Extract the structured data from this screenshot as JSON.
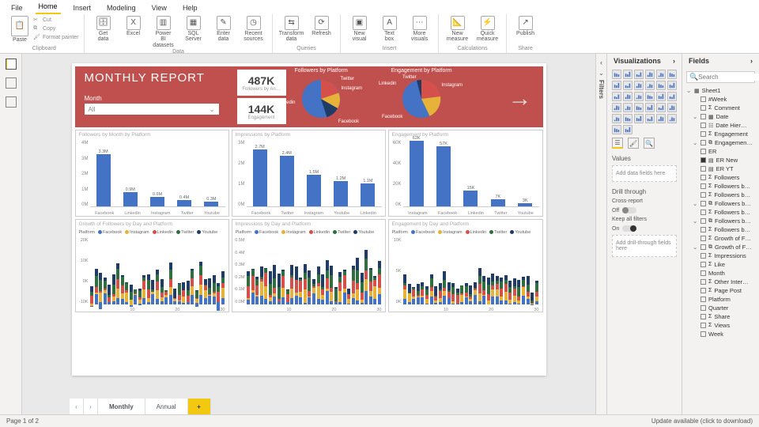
{
  "tabs": [
    "File",
    "Home",
    "Insert",
    "Modeling",
    "View",
    "Help"
  ],
  "active_tab": "Home",
  "ribbon": {
    "clipboard": {
      "label": "Clipboard",
      "paste": "Paste",
      "cut": "Cut",
      "copy": "Copy",
      "fp": "Format painter"
    },
    "data": {
      "label": "Data",
      "items": [
        "Get data",
        "Excel",
        "Power BI datasets",
        "SQL Server",
        "Enter data",
        "Recent sources"
      ]
    },
    "queries": {
      "label": "Queries",
      "items": [
        "Transform data",
        "Refresh"
      ]
    },
    "insert": {
      "label": "Insert",
      "items": [
        "New visual",
        "Text box",
        "More visuals"
      ]
    },
    "calc": {
      "label": "Calculations",
      "items": [
        "New measure",
        "Quick measure"
      ]
    },
    "share": {
      "label": "Share",
      "items": [
        "Publish"
      ]
    }
  },
  "pageinfo": "Page 1 of 2",
  "update": "Update available (click to download)",
  "pages": [
    "Monthly",
    "Annual"
  ],
  "active_page": "Monthly",
  "filters_label": "Filters",
  "viz": {
    "title": "Visualizations",
    "values": "Values",
    "addfields": "Add data fields here",
    "drill": "Drill through",
    "cross": "Cross-report",
    "off": "Off",
    "keep": "Keep all filters",
    "on": "On",
    "adddrill": "Add drill-through fields here"
  },
  "fields": {
    "title": "Fields",
    "search": "Search",
    "table": "Sheet1",
    "items": [
      {
        "name": "#Week",
        "lvl": 2,
        "sigma": false
      },
      {
        "name": "Comment",
        "lvl": 2,
        "sigma": true
      },
      {
        "name": "Date",
        "lvl": 2,
        "expand": true,
        "calendar": true
      },
      {
        "name": "Date Hier…",
        "lvl": 3,
        "hier": true
      },
      {
        "name": "Engagement",
        "lvl": 2,
        "sigma": true
      },
      {
        "name": "Engagemen…",
        "lvl": 2,
        "expand": true,
        "group": true
      },
      {
        "name": "ER",
        "lvl": 3
      },
      {
        "name": "ER New",
        "lvl": 2,
        "checked": true,
        "calc": true
      },
      {
        "name": "ER YT",
        "lvl": 2,
        "calc": true
      },
      {
        "name": "Followers",
        "lvl": 2,
        "sigma": true
      },
      {
        "name": "Followers b…",
        "lvl": 2,
        "sigma": true
      },
      {
        "name": "Followers b…",
        "lvl": 2,
        "sigma": true
      },
      {
        "name": "Followers b…",
        "lvl": 2,
        "expand": true,
        "group": true
      },
      {
        "name": "Followers b…",
        "lvl": 3,
        "sigma": true
      },
      {
        "name": "Followers b…",
        "lvl": 2,
        "expand": true,
        "group": true
      },
      {
        "name": "Followers b…",
        "lvl": 3,
        "sigma": true
      },
      {
        "name": "Growth of F…",
        "lvl": 3,
        "sigma": true
      },
      {
        "name": "Growth of F…",
        "lvl": 2,
        "expand": true,
        "group": true
      },
      {
        "name": "Impressions",
        "lvl": 3,
        "sigma": true
      },
      {
        "name": "Like",
        "lvl": 2,
        "sigma": true
      },
      {
        "name": "Month",
        "lvl": 2
      },
      {
        "name": "Other Inter…",
        "lvl": 2,
        "sigma": true
      },
      {
        "name": "Page Post",
        "lvl": 2,
        "sigma": true
      },
      {
        "name": "Platform",
        "lvl": 2
      },
      {
        "name": "Quarter",
        "lvl": 2
      },
      {
        "name": "Share",
        "lvl": 2,
        "sigma": true
      },
      {
        "name": "Views",
        "lvl": 2,
        "sigma": true
      },
      {
        "name": "Week",
        "lvl": 2
      }
    ]
  },
  "report": {
    "title": "MONTHLY REPORT",
    "slicer_label": "Month",
    "slicer_value": "All",
    "cards": [
      {
        "value": "487K",
        "label": "Followers by An…"
      },
      {
        "value": "144K",
        "label": "Engagement"
      }
    ],
    "pie1": {
      "title": "Followers by Platform",
      "labels": [
        "Twitter",
        "Instagram",
        "Linkedin",
        "Facebook"
      ]
    },
    "pie2": {
      "title": "Engagement by Platform",
      "labels": [
        "Twitter",
        "Linkedin",
        "Instagram",
        "Facebook"
      ]
    }
  },
  "chart_data": [
    {
      "type": "bar",
      "title": "Followers by Month by Platform",
      "categories": [
        "Facebook",
        "Linkedin",
        "Instagram",
        "Twitter",
        "Youtube"
      ],
      "values": [
        3300000,
        900000,
        600000,
        400000,
        300000
      ],
      "labels": [
        "3.3M",
        "0.9M",
        "0.6M",
        "0.4M",
        "0.3M"
      ],
      "ylabel": "",
      "ylim": [
        0,
        4000000
      ],
      "yticks": [
        "4M",
        "3M",
        "2M",
        "1M",
        "0M"
      ]
    },
    {
      "type": "bar",
      "title": "Impressions by Platform",
      "categories": [
        "Facebook",
        "Twitter",
        "Instagram",
        "Youtube",
        "Linkedin"
      ],
      "values": [
        2700000,
        2400000,
        1500000,
        1200000,
        1100000
      ],
      "labels": [
        "2.7M",
        "2.4M",
        "1.5M",
        "1.2M",
        "1.1M"
      ],
      "ylim": [
        0,
        3000000
      ],
      "yticks": [
        "3M",
        "2M",
        "1M",
        "0M"
      ]
    },
    {
      "type": "bar",
      "title": "Engagement by Platform",
      "categories": [
        "Instagram",
        "Facebook",
        "Linkedin",
        "Twitter",
        "Youtube"
      ],
      "values": [
        62000,
        57000,
        15000,
        7000,
        3000
      ],
      "labels": [
        "62K",
        "57K",
        "15K",
        "7K",
        "3K"
      ],
      "ylim": [
        0,
        60000
      ],
      "yticks": [
        "60K",
        "40K",
        "20K",
        "0K"
      ]
    },
    {
      "type": "stacked-bar",
      "title": "Growth of Followers by Day and Platform",
      "legend_label": "Platform",
      "x_range": [
        1,
        31
      ],
      "xticks": [
        "",
        "10",
        "20",
        "30"
      ],
      "yticks": [
        "20K",
        "10K",
        "0K",
        "-10K"
      ],
      "ylim": [
        -10000,
        25000
      ],
      "series": [
        {
          "name": "Facebook",
          "color": "#4472c4"
        },
        {
          "name": "Instagram",
          "color": "#e6b23a"
        },
        {
          "name": "Linkedin",
          "color": "#d5504b"
        },
        {
          "name": "Twitter",
          "color": "#2f6f3f"
        },
        {
          "name": "Youtube",
          "color": "#1f3b66"
        }
      ]
    },
    {
      "type": "stacked-bar",
      "title": "Impressions by Day and Platform",
      "legend_label": "Platform",
      "x_range": [
        1,
        31
      ],
      "xticks": [
        "",
        "10",
        "20",
        "30"
      ],
      "yticks": [
        "0.5M",
        "0.4M",
        "0.3M",
        "0.2M",
        "0.1M",
        "0.0M"
      ],
      "ylim": [
        0,
        500000
      ],
      "series": [
        {
          "name": "Facebook",
          "color": "#4472c4"
        },
        {
          "name": "Instagram",
          "color": "#e6b23a"
        },
        {
          "name": "Linkedin",
          "color": "#d5504b"
        },
        {
          "name": "Twitter",
          "color": "#2f6f3f"
        },
        {
          "name": "Youtube",
          "color": "#1f3b66"
        }
      ]
    },
    {
      "type": "stacked-bar",
      "title": "Engagement by Day and Platform",
      "legend_label": "Platform",
      "x_range": [
        1,
        31
      ],
      "xticks": [
        "",
        "10",
        "20",
        "30"
      ],
      "yticks": [
        "10K",
        "5K",
        "0K"
      ],
      "ylim": [
        0,
        10000
      ],
      "series": [
        {
          "name": "Facebook",
          "color": "#4472c4"
        },
        {
          "name": "Instagram",
          "color": "#e6b23a"
        },
        {
          "name": "Linkedin",
          "color": "#d5504b"
        },
        {
          "name": "Twitter",
          "color": "#2f6f3f"
        },
        {
          "name": "Youtube",
          "color": "#1f3b66"
        }
      ]
    }
  ]
}
